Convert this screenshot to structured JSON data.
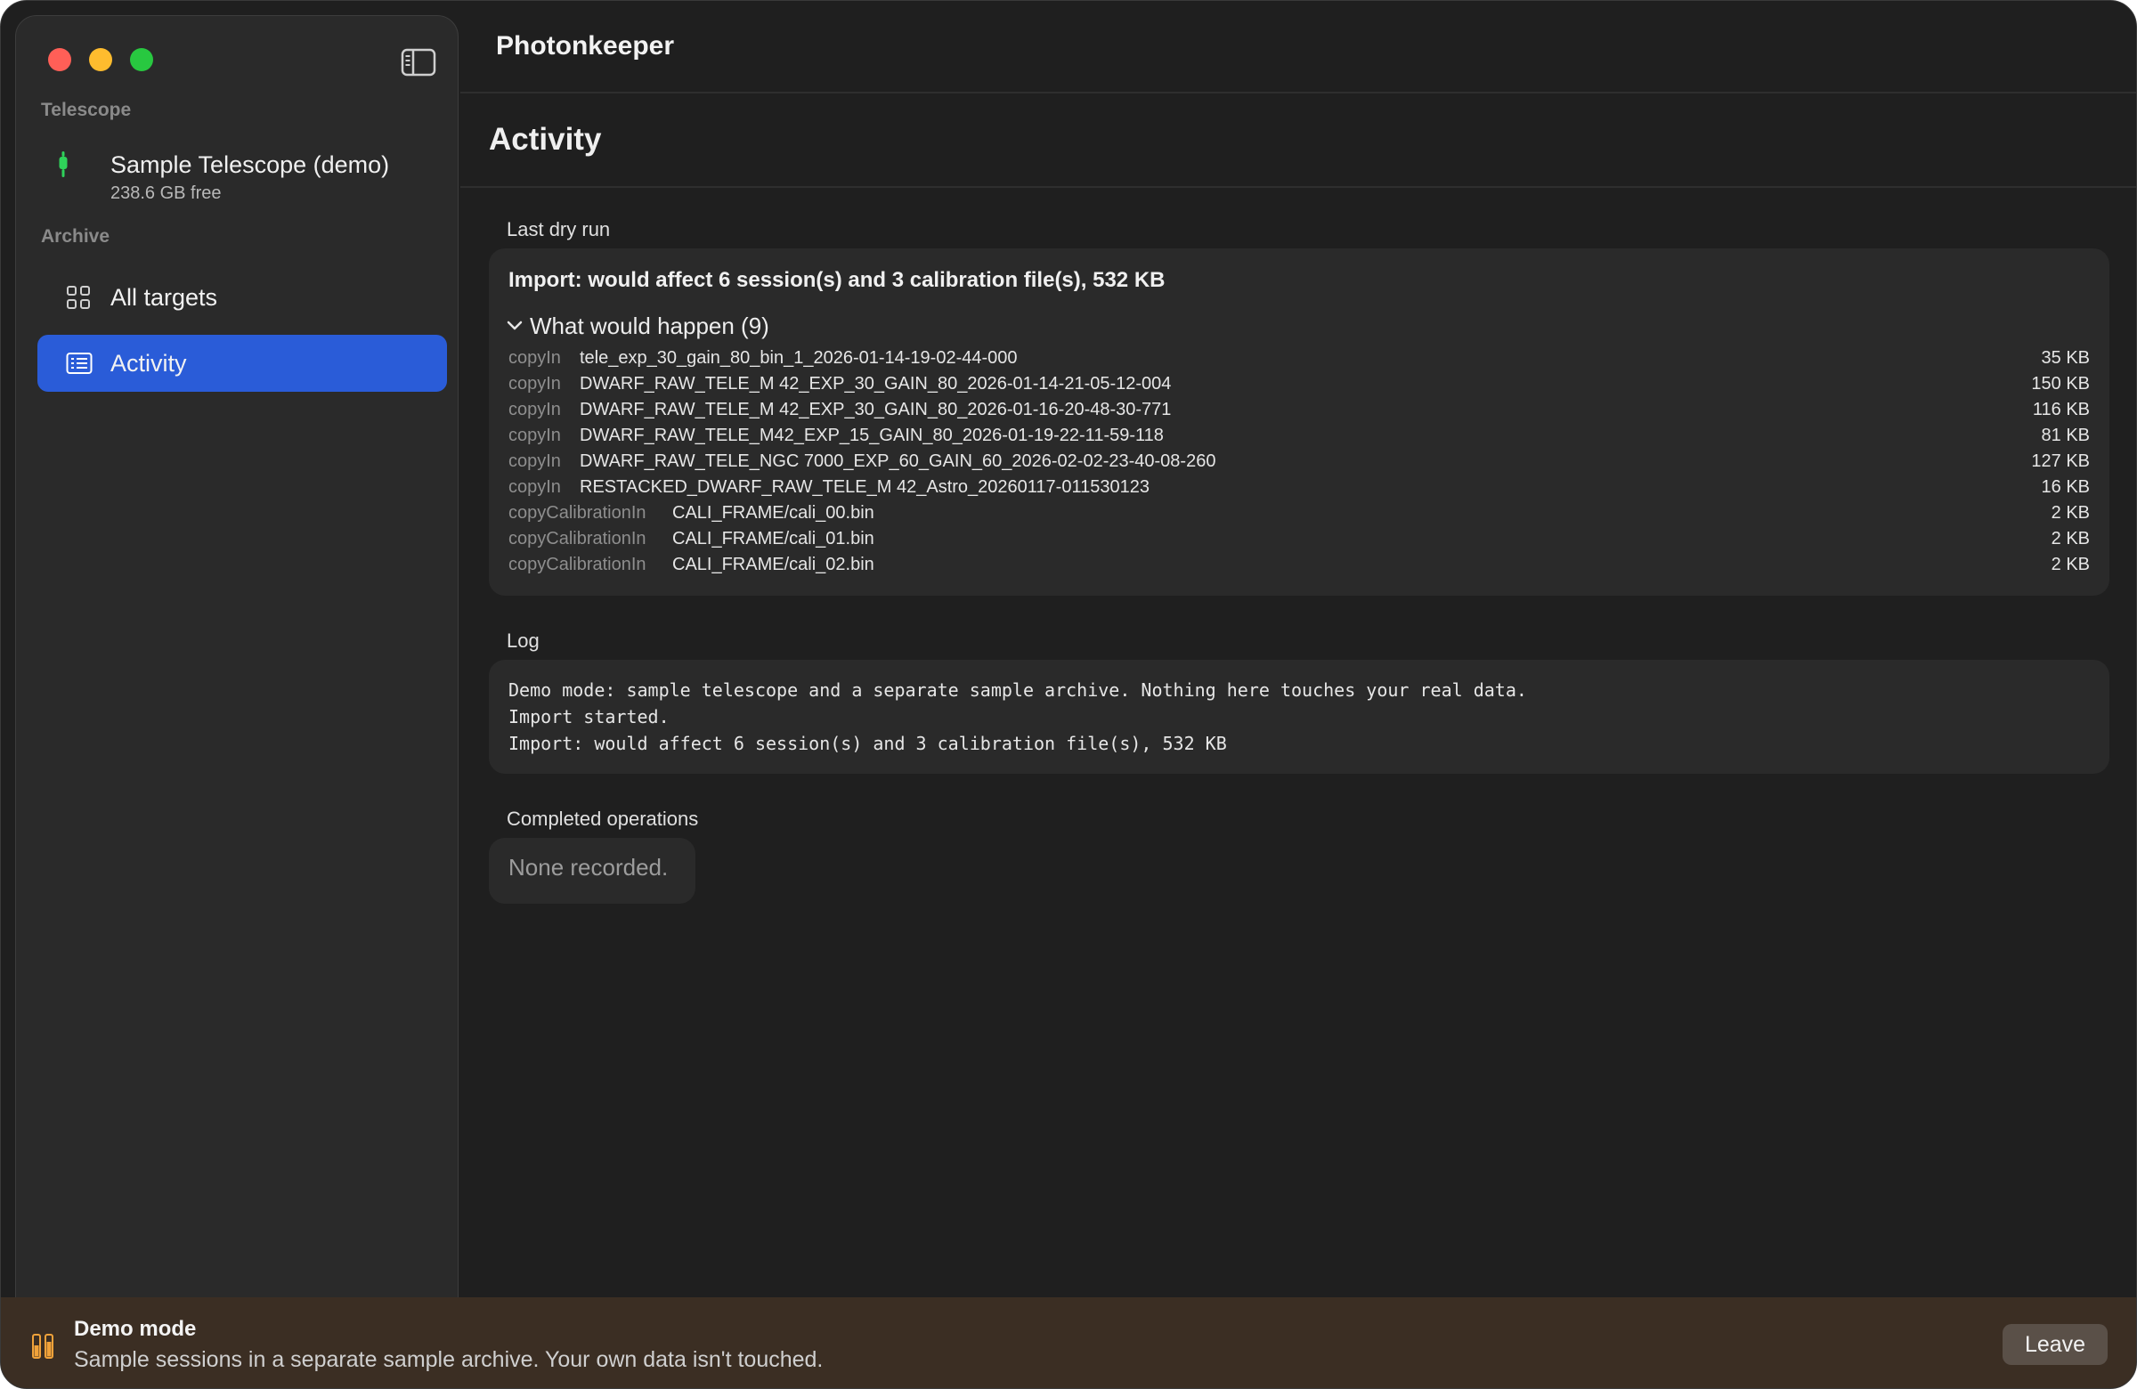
{
  "app": {
    "title": "Photonkeeper"
  },
  "sidebar": {
    "telescope_section": "Telescope",
    "telescope": {
      "name": "Sample Telescope (demo)",
      "free": "238.6 GB free"
    },
    "archive_section": "Archive",
    "items": [
      {
        "label": "All targets",
        "icon": "grid-icon"
      },
      {
        "label": "Activity",
        "icon": "list-icon",
        "active": true
      }
    ]
  },
  "main": {
    "heading": "Activity",
    "dry_run": {
      "label": "Last dry run",
      "summary": "Import: would affect 6 session(s) and 3 calibration file(s), 532 KB",
      "disclosure": "What would happen (9)",
      "operations": [
        {
          "kind": "copyIn",
          "file": "tele_exp_30_gain_80_bin_1_2026-01-14-19-02-44-000",
          "size": "35 KB"
        },
        {
          "kind": "copyIn",
          "file": "DWARF_RAW_TELE_M 42_EXP_30_GAIN_80_2026-01-14-21-05-12-004",
          "size": "150 KB"
        },
        {
          "kind": "copyIn",
          "file": "DWARF_RAW_TELE_M 42_EXP_30_GAIN_80_2026-01-16-20-48-30-771",
          "size": "116 KB"
        },
        {
          "kind": "copyIn",
          "file": "DWARF_RAW_TELE_M42_EXP_15_GAIN_80_2026-01-19-22-11-59-118",
          "size": "81 KB"
        },
        {
          "kind": "copyIn",
          "file": "DWARF_RAW_TELE_NGC 7000_EXP_60_GAIN_60_2026-02-02-23-40-08-260",
          "size": "127 KB"
        },
        {
          "kind": "copyIn",
          "file": "RESTACKED_DWARF_RAW_TELE_M 42_Astro_20260117-011530123",
          "size": "16 KB"
        },
        {
          "kind": "copyCalibrationIn",
          "file": "CALI_FRAME/cali_00.bin",
          "size": "2 KB"
        },
        {
          "kind": "copyCalibrationIn",
          "file": "CALI_FRAME/cali_01.bin",
          "size": "2 KB"
        },
        {
          "kind": "copyCalibrationIn",
          "file": "CALI_FRAME/cali_02.bin",
          "size": "2 KB"
        }
      ]
    },
    "log": {
      "label": "Log",
      "lines": [
        "Demo mode: sample telescope and a separate sample archive. Nothing here touches your real data.",
        "Import started.",
        "Import: would affect 6 session(s) and 3 calibration file(s), 532 KB"
      ]
    },
    "completed": {
      "label": "Completed operations",
      "empty_text": "None recorded."
    }
  },
  "banner": {
    "title": "Demo mode",
    "text": "Sample sessions in a separate sample archive. Your own data isn't touched.",
    "leave_label": "Leave",
    "icon": "flask-icon",
    "color": "#3b2e23"
  },
  "colors": {
    "accent": "#2a5cd8",
    "telescope_status": "#2fd25a"
  }
}
